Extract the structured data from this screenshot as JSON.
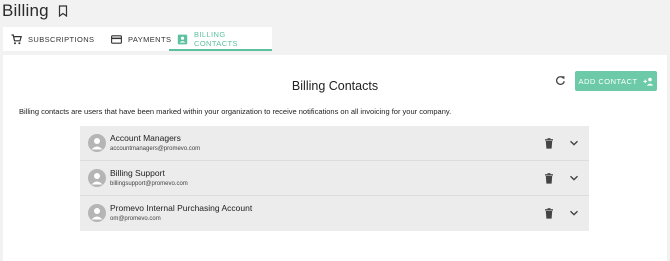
{
  "page": {
    "title": "Billing"
  },
  "tabs": [
    {
      "label": "SUBSCRIPTIONS",
      "icon": "cart-icon",
      "active": false
    },
    {
      "label": "PAYMENTS",
      "icon": "credit-card-icon",
      "active": false
    },
    {
      "label": "BILLING CONTACTS",
      "icon": "contact-card-icon",
      "active": true
    }
  ],
  "billing_contacts": {
    "title": "Billing Contacts",
    "description": "Billing contacts are users that have been marked within your organization to receive notifications on all invoicing for your company.",
    "add_button_label": "ADD CONTACT",
    "contacts": [
      {
        "name": "Account Managers",
        "email": "accountmanagers@promevo.com"
      },
      {
        "name": "Billing Support",
        "email": "billingsupport@promevo.com"
      },
      {
        "name": "Promevo Internal Purchasing Account",
        "email": "om@promevo.com"
      }
    ]
  },
  "colors": {
    "accent": "#5cc1a0",
    "button": "#6ccaa9"
  }
}
